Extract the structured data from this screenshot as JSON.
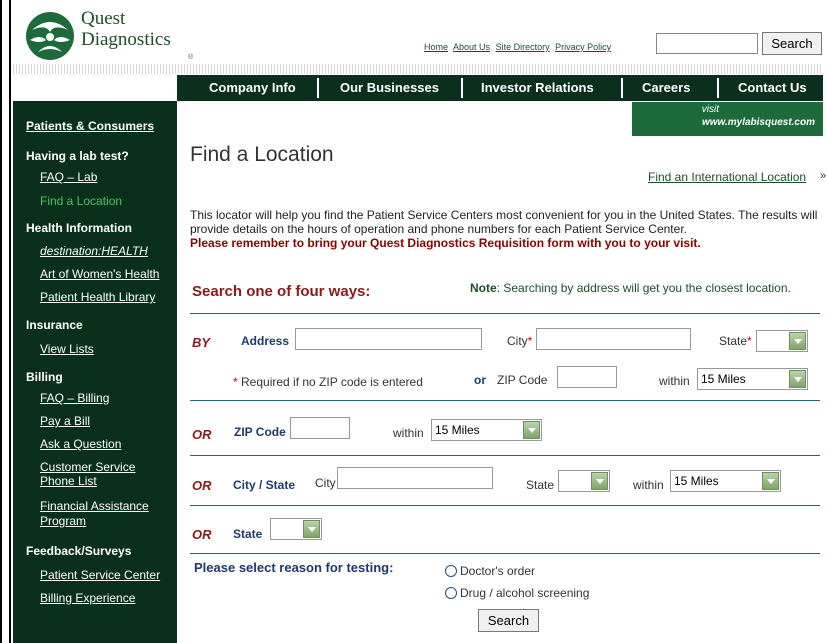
{
  "brand": {
    "line1": "Quest",
    "line2": "Diagnostics",
    "reg": "®"
  },
  "toplinks": [
    "Home",
    "About Us",
    "Site Directory",
    "Privacy Policy"
  ],
  "search": {
    "button": "Search"
  },
  "nav": [
    "Company Info",
    "Our Businesses",
    "Investor Relations",
    "Careers",
    "Contact Us"
  ],
  "banner": {
    "visit": "visit",
    "url": "www.mylabisquest.com"
  },
  "sidebar": {
    "top": "Patients & Consumers",
    "sections": [
      {
        "head": "Having a lab test?",
        "links": [
          "FAQ – Lab",
          "Find a Location"
        ]
      },
      {
        "head": "Health Information",
        "links": [
          "destination:HEALTH",
          "Art of Women's Health",
          "Patient Health Library"
        ]
      },
      {
        "head": "Insurance",
        "links": [
          "View Lists"
        ]
      },
      {
        "head": "Billing",
        "links": [
          "FAQ – Billing",
          "Pay a Bill",
          "Ask a Question",
          "Customer Service",
          "Phone List",
          "Financial Assistance",
          "Program"
        ]
      },
      {
        "head": "Feedback/Surveys",
        "links": [
          "Patient Service Center",
          "Billing Experience"
        ]
      }
    ]
  },
  "main": {
    "title": "Find a Location",
    "intl_link": "Find an International Location",
    "intl_arrow": "»",
    "intro1": "This locator will help you find the Patient Service Centers most convenient for you in the United States. The results will provide details on the hours of operation and phone numbers for each Patient Service Center.",
    "intro2": "Please remember to bring your Quest Diagnostics Requisition form with you to your visit.",
    "search_ways": "Search one of four ways:",
    "note_label": "Note",
    "note_text": ": Searching by address will get you the closest location."
  },
  "form": {
    "by": "BY",
    "or": "OR",
    "or_small": "or",
    "address": "Address",
    "city": "City",
    "state": "State",
    "asterisk": "*",
    "required_note": "* Required if no ZIP code is entered",
    "zip_code": "ZIP Code",
    "within": "within",
    "miles": "15 Miles",
    "city_state": "City / State",
    "reason_label": "Please select reason for testing:",
    "reason1": "Doctor's order",
    "reason2": "Drug / alcohol screening",
    "submit": "Search"
  }
}
